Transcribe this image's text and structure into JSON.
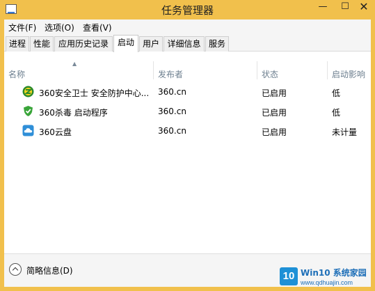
{
  "window": {
    "title": "任务管理器",
    "minimize": "—",
    "maximize": "☐",
    "close": "✕"
  },
  "menu": [
    {
      "label": "文件(F)"
    },
    {
      "label": "选项(O)"
    },
    {
      "label": "查看(V)"
    }
  ],
  "tabs": [
    {
      "label": "进程"
    },
    {
      "label": "性能"
    },
    {
      "label": "应用历史记录"
    },
    {
      "label": "启动",
      "active": true
    },
    {
      "label": "用户"
    },
    {
      "label": "详细信息"
    },
    {
      "label": "服务"
    }
  ],
  "columns": {
    "name": "名称",
    "publisher": "发布者",
    "status": "状态",
    "impact": "启动影响"
  },
  "rows": [
    {
      "icon": "360-safe-guard-icon",
      "name": "360安全卫士 安全防护中心...",
      "publisher": "360.cn",
      "status": "已启用",
      "impact": "低"
    },
    {
      "icon": "360-antivirus-icon",
      "name": "360杀毒 启动程序",
      "publisher": "360.cn",
      "status": "已启用",
      "impact": "低"
    },
    {
      "icon": "360-cloud-drive-icon",
      "name": "360云盘",
      "publisher": "360.cn",
      "status": "已启用",
      "impact": "未计量"
    }
  ],
  "footer": {
    "label": "简略信息(D)"
  },
  "watermark": {
    "logo": "10",
    "line1": "Win10 系统家园",
    "line2": "www.qdhuajin.com"
  },
  "colors": {
    "titlebar": "#f1c04c",
    "header_text": "#6d7f8f",
    "watermark": "#1e6fb8"
  }
}
